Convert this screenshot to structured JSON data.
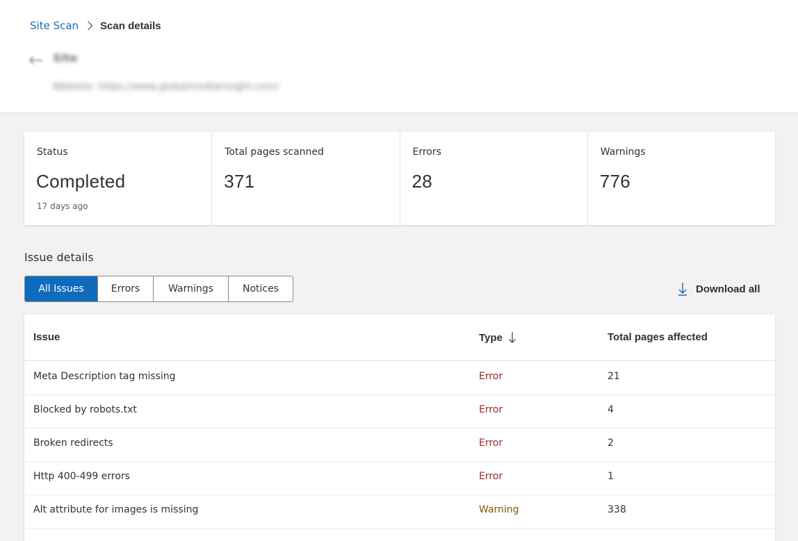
{
  "breadcrumb": {
    "parent": "Site Scan",
    "current": "Scan details"
  },
  "site": {
    "title": "Site",
    "website": "Website: https://www.globalmediainsight.com/"
  },
  "summary": {
    "status": {
      "label": "Status",
      "value": "Completed",
      "sub": "17 days ago"
    },
    "pages": {
      "label": "Total pages scanned",
      "value": "371"
    },
    "errors": {
      "label": "Errors",
      "value": "28"
    },
    "warnings": {
      "label": "Warnings",
      "value": "776"
    }
  },
  "issues": {
    "title": "Issue details",
    "filters": [
      {
        "label": "All Issues",
        "active": true
      },
      {
        "label": "Errors",
        "active": false
      },
      {
        "label": "Warnings",
        "active": false
      },
      {
        "label": "Notices",
        "active": false
      }
    ],
    "download_label": "Download all",
    "columns": {
      "issue": "Issue",
      "type": "Type",
      "pages": "Total pages affected"
    },
    "rows": [
      {
        "issue": "Meta Description tag missing",
        "type": "Error",
        "pages": "21"
      },
      {
        "issue": "Blocked by robots.txt",
        "type": "Error",
        "pages": "4"
      },
      {
        "issue": "Broken redirects",
        "type": "Error",
        "pages": "2"
      },
      {
        "issue": "Http 400-499 errors",
        "type": "Error",
        "pages": "1"
      },
      {
        "issue": "Alt attribute for images is missing",
        "type": "Warning",
        "pages": "338"
      }
    ]
  },
  "colors": {
    "accent": "#0f6cbd",
    "error": "#a4262c",
    "warning": "#835b00"
  }
}
